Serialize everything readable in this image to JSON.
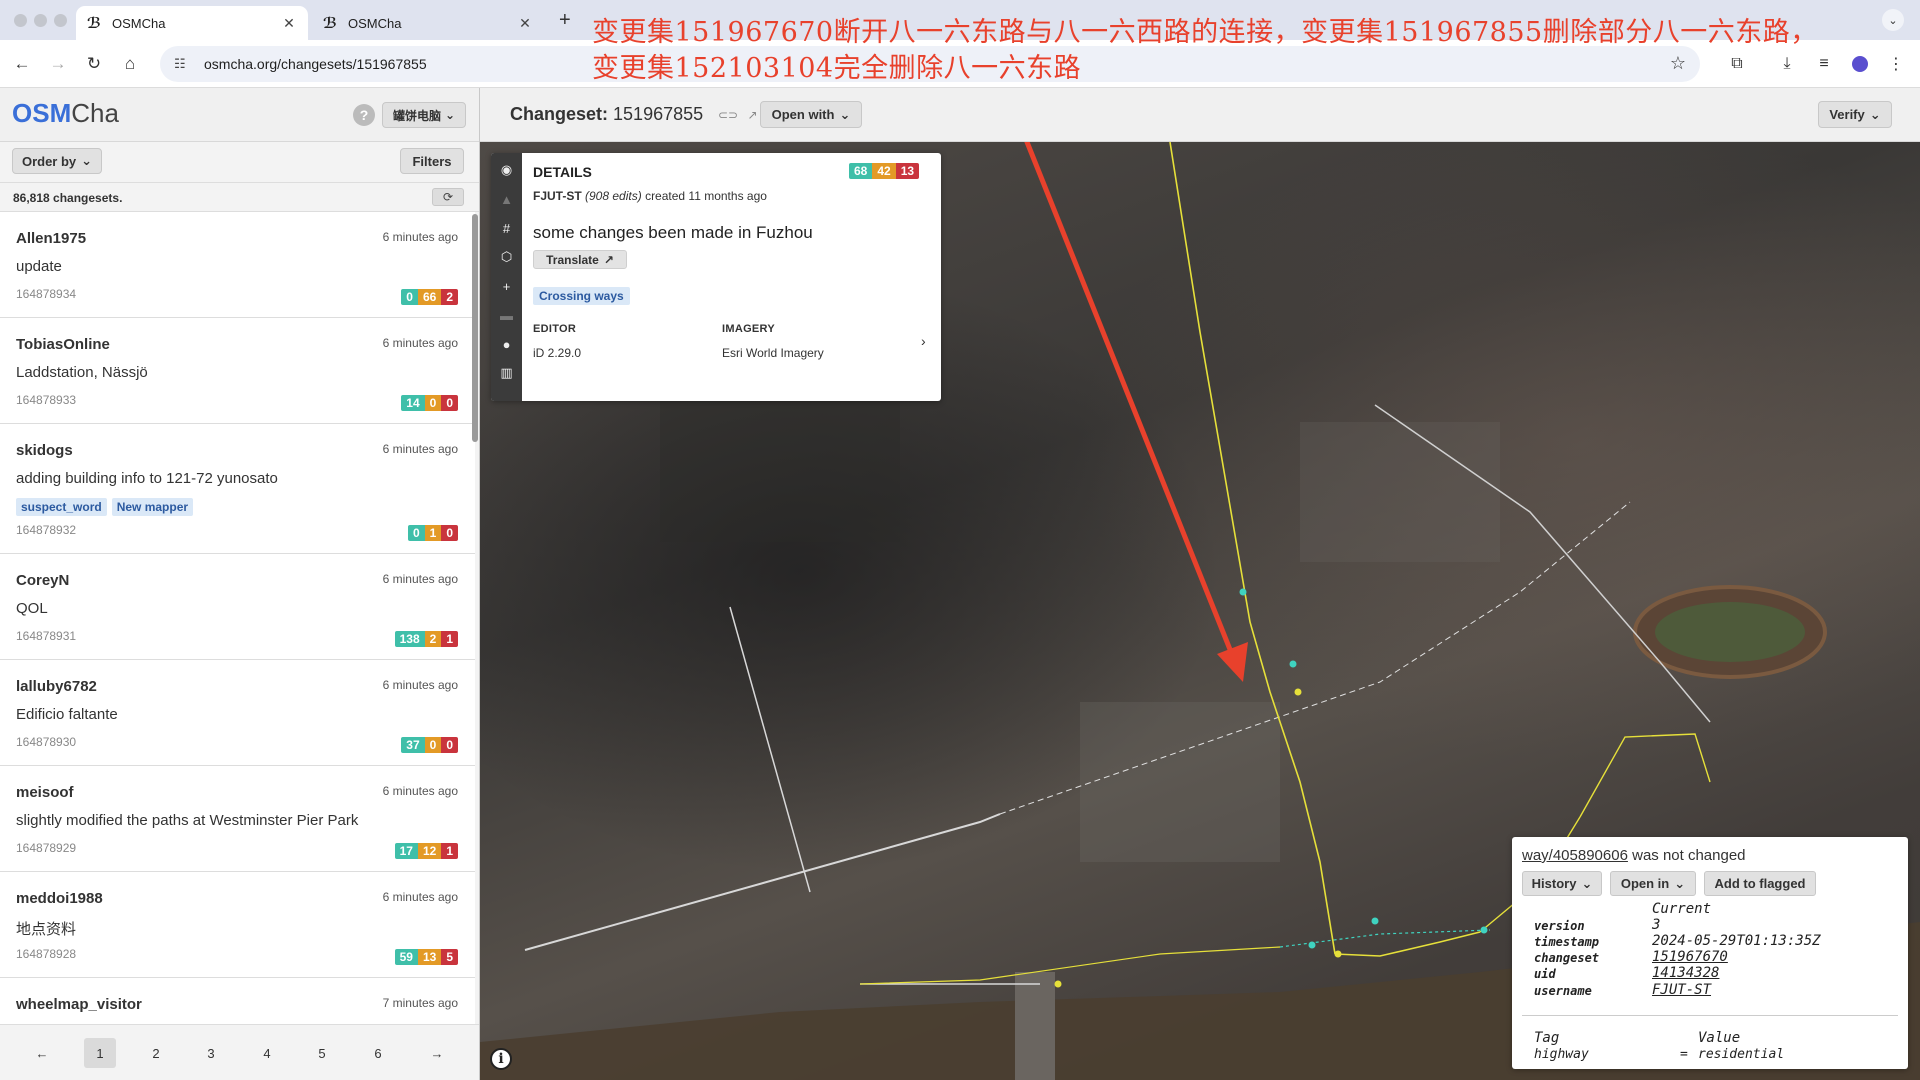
{
  "browser": {
    "tabs": [
      {
        "title": "OSMCha",
        "active": true
      },
      {
        "title": "OSMCha",
        "active": false
      }
    ],
    "url": "osmcha.org/changesets/151967855"
  },
  "annotation": {
    "line1": "变更集151967670断开八一六东路与八一六西路的连接，变更集151967855删除部分八一六东路，",
    "line2": "变更集152103104完全删除八一六东路",
    "color": "#e8412c"
  },
  "app": {
    "brand_bold": "OSM",
    "brand_rest": "Cha",
    "help": "?",
    "user_button": "罐饼电脑",
    "changeset_label": "Changeset:",
    "changeset_id": "151967855",
    "open_with": "Open with",
    "verify": "Verify"
  },
  "sidebar": {
    "order_by": "Order by",
    "filters": "Filters",
    "count": "86,818 changesets.",
    "items": [
      {
        "user": "Allen1975",
        "time": "6 minutes ago",
        "comment": "update",
        "id": "164878934",
        "tags": [],
        "counts": [
          "0",
          "66",
          "2"
        ]
      },
      {
        "user": "TobiasOnline",
        "time": "6 minutes ago",
        "comment": "Laddstation, Nässjö",
        "id": "164878933",
        "tags": [],
        "counts": [
          "14",
          "0",
          "0"
        ]
      },
      {
        "user": "skidogs",
        "time": "6 minutes ago",
        "comment": "adding building info to 121-72 yunosato",
        "id": "164878932",
        "tags": [
          "suspect_word",
          "New mapper"
        ],
        "counts": [
          "0",
          "1",
          "0"
        ]
      },
      {
        "user": "CoreyN",
        "time": "6 minutes ago",
        "comment": "QOL",
        "id": "164878931",
        "tags": [],
        "counts": [
          "138",
          "2",
          "1"
        ]
      },
      {
        "user": "lalluby6782",
        "time": "6 minutes ago",
        "comment": "Edificio faltante",
        "id": "164878930",
        "tags": [],
        "counts": [
          "37",
          "0",
          "0"
        ]
      },
      {
        "user": "meisoof",
        "time": "6 minutes ago",
        "comment": "slightly modified the paths at Westminster Pier Park",
        "id": "164878929",
        "tags": [],
        "counts": [
          "17",
          "12",
          "1"
        ]
      },
      {
        "user": "meddoi1988",
        "time": "6 minutes ago",
        "comment": "地点资料",
        "id": "164878928",
        "tags": [],
        "counts": [
          "59",
          "13",
          "5"
        ]
      },
      {
        "user": "wheelmap_visitor",
        "time": "7 minutes ago",
        "comment": "",
        "id": "",
        "tags": [],
        "counts": []
      }
    ],
    "pager": {
      "prev": "←",
      "pages": [
        "1",
        "2",
        "3",
        "4",
        "5",
        "6"
      ],
      "next": "→",
      "current": "1"
    }
  },
  "details": {
    "title": "DETAILS",
    "counts": [
      "68",
      "42",
      "13"
    ],
    "user": "FJUT-ST",
    "edits": "(908 edits)",
    "created": "created 11 months ago",
    "comment": "some changes been made in Fuzhou",
    "translate": "Translate",
    "flag": "Crossing ways",
    "editor_label": "EDITOR",
    "editor_value": "iD 2.29.0",
    "imagery_label": "IMAGERY",
    "imagery_value": "Esri World Imagery"
  },
  "feature": {
    "way_link": "way/405890606",
    "status": " was not changed",
    "history": "History",
    "open_in": "Open in",
    "add_flagged": "Add to flagged",
    "current_header": "Current",
    "rows": [
      {
        "key": "version",
        "value": "3"
      },
      {
        "key": "timestamp",
        "value": "2024-05-29T01:13:35Z"
      },
      {
        "key": "changeset",
        "value": "151967670"
      },
      {
        "key": "uid",
        "value": "14134328"
      },
      {
        "key": "username",
        "value": "FJUT-ST"
      }
    ],
    "tag_header": "Tag",
    "value_header": "Value",
    "tag_key": "highway",
    "tag_eq": "=",
    "tag_value": "residential"
  },
  "colors": {
    "brand": "#3a6fd8",
    "added": "#3fbfa9",
    "modified": "#e39a26",
    "deleted": "#c9343d",
    "tag_bg": "#dae8f7",
    "way_yellow": "#e6e03a",
    "node_cyan": "#3fd3c0",
    "arrow_red": "#e8412c"
  }
}
